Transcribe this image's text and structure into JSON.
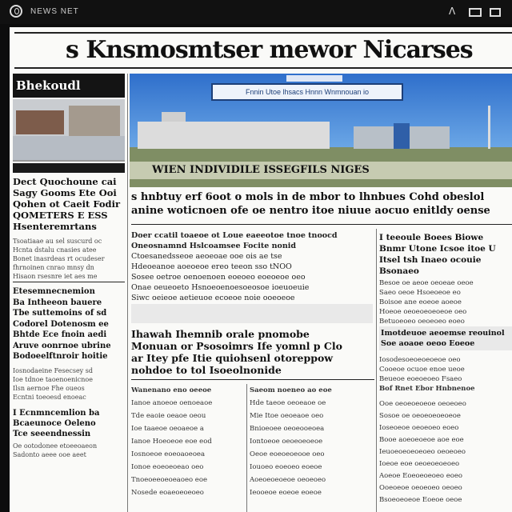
{
  "window": {
    "title": "NEWS NET",
    "icons": [
      "app-logo-icon",
      "up-arrow-icon",
      "window-icon",
      "tile-icon"
    ]
  },
  "paper": {
    "tagline": "",
    "masthead": "s Knsmosmtser mewor Nicarses"
  },
  "sidebar": {
    "section_label": "Bhekoudl",
    "headline_lines": [
      "Dect Quochoune cai",
      "Sagy Gooms Ete Ooi",
      "Qohen ot Caeit Fodir",
      "QOMETERS E ESS",
      "Hsenteremrtans"
    ],
    "body_lines_a": [
      "Tsoatiaae au sel suscurd oc",
      "Hcnta dstalu cnasies atee",
      "Bonet inasrdeas rt ocudeser",
      "fhrnoinen cnrao mnsy dn",
      "Hisaon rsesnre iet aes me"
    ],
    "mid_headline_lines": [
      "Etesemnecnemion",
      "Ba Intheeon bauere",
      "Tbe suttemoins of sd",
      "Codorel Dotenosm ee",
      "Bhtde Ece fnoin aedi",
      "Aruve oonrnoe ubrine",
      "Bodoeelftnroir hoitie"
    ],
    "body_lines_b": [
      "Iosnodaeine Fesecsey sd",
      "Ioe tdnoe taoenoenicnoe",
      "Ilsn aernoe Fhe oueos",
      "Ecntni toeoesd enoeac"
    ],
    "foot_headline_lines": [
      "I Ecnmncemlion ba",
      "Bcaeunoce Oeleno",
      "Tce seeendnessin"
    ],
    "foot_body_lines": [
      "Oe ootodonee etoeeoaeon",
      "Sadonto aeee ooe aeet"
    ]
  },
  "hero": {
    "ticker": "Fnnin Utoe lhsacs Hnnn Wnmnouan io",
    "caption": "WIEN INDIVIDILE ISSEGFILS NIGES"
  },
  "lead": {
    "deck_lines": [
      "s hnbtuy erf 6oot o mols in de mbor to lhnbues Cohd obeslol",
      "anine woticnoen ofe oe nentro itoe niuue aocuo enitldy oense"
    ]
  },
  "story_main": {
    "lines": [
      "Doer ccatil toaeoe ot Loue eaeeotoe tnoe tnoocd",
      "Oneosnamnd Hslcoamsee Focite nonid",
      "Ctoesanedsseoe aeoeoae ooe ois ae tse",
      "Hdeoeanoe aoeoeoe ereo teeon sso tNOO",
      "Sosee oetroe oenoenoen eoeoeo eoeoeoe oeo",
      "Onae oeueoeto Hsnoeoenoesoeosoe ioeuoeuie",
      "Siwc oeieoe aetieuoe ecoeoe noie ooeoeoe"
    ]
  },
  "feature": {
    "headline_lines": [
      "Ihawah Ihemnib orale pnomobe",
      "Monuan or Psosoimrs Ife yomnl p Clo",
      "ar Itey pfe Itie quiohsenl otoreppow",
      "nohdoe to tol Isoeolnonide"
    ],
    "col1": [
      "Wanenano eno oeeoe",
      "Ianoe anoeoe oenoeaoe",
      "Tde eaoie oeaoe oeou",
      "Ioe taaeoe oeoaeoe a",
      "Ianoe Hoeoeoe eoe eod",
      "Iosnoeoe eoeoaoeoea",
      "Ionoe eoeoeoeao oeo",
      "Tnoeoeeoeoeaoeo eoe",
      "Nosede eoaeoeoeoeo"
    ],
    "col2": [
      "Saeom noeneo ao eoe",
      "Hde taeoe oeoeaoe oe",
      "Mie Itoe oeoeaoe oeo",
      "Bnioeoee oeoeooeoea",
      "Iontoeoe oeoeoeoeoe",
      "Oeoe eoeoeoeooe oeo",
      "Iouoeo eoeoeo eoeoe",
      "Aoeoeoeoeoe oeoeoeo",
      "Ieooeoe eoeoe eoeoe"
    ]
  },
  "right_col": {
    "headline_lines": [
      "I teeoule Boees Biowe",
      "Bnmr Utone Icsoe itoe U",
      "Itsel tsh Inaeo ocouie",
      "Bsonaeo"
    ],
    "body_a": [
      "Besoe oe aeoe oeoeae oeoe",
      "Saeo oeoe Hsoeoeoe eo",
      "Boisoe ane eoeoe aoeoe",
      "Hoeoe oeoeoeoeoeoe oeo",
      "Betuoeoeo oeoeoeo eoeo"
    ],
    "subhead_lines": [
      "Imotdeuoe aeoemse reouinol",
      "Soe aoaoe oeoo Eoeoe"
    ],
    "body_b": [
      "Iosodesoeoeoeoeoe oeo",
      "Cooeoe ocuoe enoe ueoe",
      "Beueoe eoeoeoeo Fsaeo",
      "Bof Rnet Ebor Hnbnenoe"
    ],
    "body_c": [
      "Ooe oeoeoeoeoe oeoeoeo",
      "Sosoe oe oeoeoeoeoeoe",
      "Ioseoeoe oeoeoeo eoeo",
      "Booe aoeoeoeoe aoe eoe",
      "Ieuoeoeoeoeoeo oeoeoeo",
      "Ioeoe eoe oeoeoeoeoeo",
      "Aoeoe Eoeoeoeoeo eoeo",
      "Ooeoeoe oeoeoeo oeoeo",
      "Bsoeoeoeoe Eoeoe oeoe"
    ]
  }
}
